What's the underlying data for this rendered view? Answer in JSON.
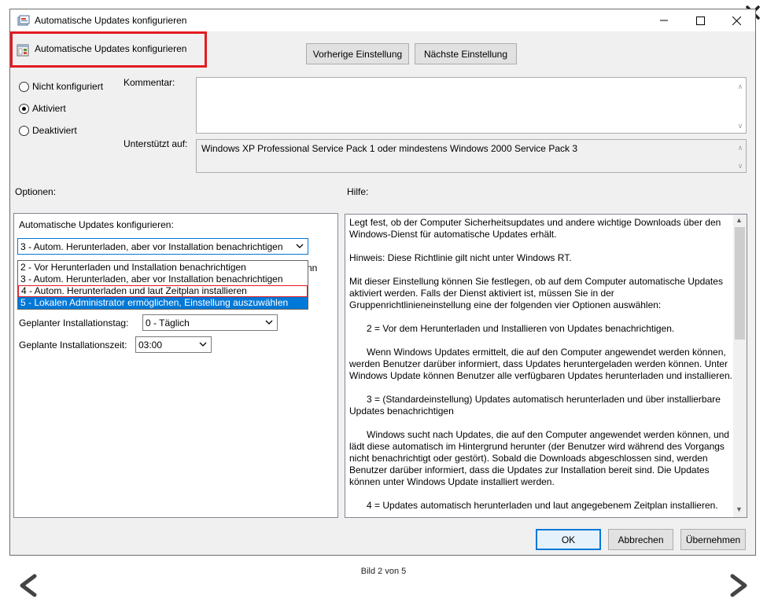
{
  "window": {
    "title": "Automatische Updates konfigurieren"
  },
  "header": {
    "policy_name": "Automatische Updates konfigurieren",
    "prev_button": "Vorherige Einstellung",
    "next_button": "Nächste Einstellung"
  },
  "state": {
    "options": [
      "Nicht konfiguriert",
      "Aktiviert",
      "Deaktiviert"
    ],
    "selected": "Aktiviert"
  },
  "labels": {
    "comment": "Kommentar:",
    "supported": "Unterstützt auf:",
    "options": "Optionen:",
    "help": "Hilfe:"
  },
  "comment_value": "",
  "supported_value": "Windows XP Professional Service Pack 1 oder mindestens Windows 2000 Service Pack 3",
  "options_panel": {
    "configure_label": "Automatische Updates konfigurieren:",
    "configure_value": "3 - Autom. Herunterladen, aber vor Installation benachrichtigen",
    "dropdown_items": [
      "2 - Vor Herunterladen und Installation benachrichtigen",
      "3 - Autom. Herunterladen, aber vor Installation benachrichtigen",
      "4 - Autom. Herunterladen und laut Zeitplan installieren",
      "5 - Lokalen Administrator ermöglichen, Einstellung auszuwählen"
    ],
    "partial_text": "nn",
    "day_label": "Geplanter Installationstag:",
    "day_value": "0 - Täglich",
    "time_label": "Geplante Installationszeit:",
    "time_value": "03:00"
  },
  "help_paragraphs": [
    "Legt fest, ob der Computer Sicherheitsupdates und andere wichtige Downloads über den Windows-Dienst für automatische Updates erhält.",
    "Hinweis: Diese Richtlinie gilt nicht unter Windows RT.",
    "Mit dieser Einstellung können Sie festlegen, ob auf dem Computer automatische Updates aktiviert werden. Falls der Dienst aktiviert ist, müssen Sie in der Gruppenrichtlinieneinstellung eine der folgenden vier Optionen auswählen:",
    "2 = Vor dem Herunterladen und Installieren von Updates benachrichtigen.",
    "Wenn Windows Updates ermittelt, die auf den Computer angewendet werden können, werden Benutzer darüber informiert, dass Updates heruntergeladen werden können. Unter Windows Update können Benutzer alle verfügbaren Updates herunterladen und installieren.",
    "3 = (Standardeinstellung) Updates automatisch herunterladen und über installierbare Updates benachrichtigen",
    "Windows sucht nach Updates, die auf den Computer angewendet werden können, und lädt diese automatisch im Hintergrund herunter (der Benutzer wird während des Vorgangs nicht benachrichtigt oder gestört). Sobald die Downloads abgeschlossen sind, werden Benutzer darüber informiert, dass die Updates zur Installation bereit sind. Die Updates können unter Windows Update installiert werden.",
    "4 = Updates automatisch herunterladen und laut angegebenem Zeitplan installieren."
  ],
  "footer": {
    "ok": "OK",
    "cancel": "Abbrechen",
    "apply": "Übernehmen"
  },
  "viewer": {
    "caption": "Bild 2 von 5"
  },
  "colors": {
    "highlight_border": "#e11b22",
    "selection": "#0078d7"
  }
}
